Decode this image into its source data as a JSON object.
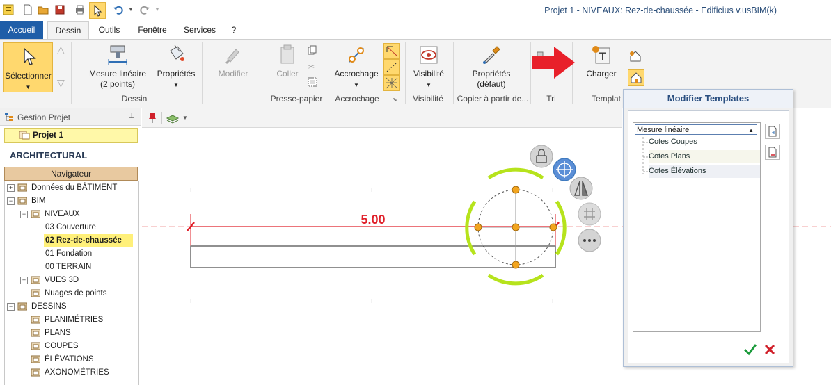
{
  "app": {
    "title": "Projet 1 -  NIVEAUX: Rez-de-chaussée - Edificius v.usBIM(k)"
  },
  "menu": {
    "tabs": [
      "Accueil",
      "Dessin",
      "Outils",
      "Fenêtre",
      "Services",
      "?"
    ]
  },
  "ribbon": {
    "select_label": "Sélectionner",
    "measure_label_1": "Mesure linéaire",
    "measure_label_2": "(2 points)",
    "properties_label": "Propriétés",
    "modify_label": "Modifier",
    "paste_label": "Coller",
    "snap_label": "Accrochage",
    "visibility_label": "Visibilité",
    "default_props_label_1": "Propriétés",
    "default_props_label_2": "(défaut)",
    "load_label": "Charger",
    "groups": {
      "dessin": "Dessin",
      "clipboard": "Presse-papier",
      "snap": "Accrochage",
      "visibility": "Visibilité",
      "copy_from": "Copier à partir de...",
      "sort": "Tri",
      "templates": "Templat"
    }
  },
  "left_panel": {
    "header": "Gestion Projet",
    "project": "Projet 1",
    "section": "ARCHITECTURAL",
    "navigator": "Navigateur",
    "tree": [
      {
        "label": "Données du BÂTIMENT",
        "level": 0,
        "expander": "+"
      },
      {
        "label": "BIM",
        "level": 0,
        "expander": "−"
      },
      {
        "label": "NIVEAUX",
        "level": 1,
        "expander": "−"
      },
      {
        "label": "03 Couverture",
        "level": 2
      },
      {
        "label": "02 Rez-de-chaussée",
        "level": 2,
        "selected": true
      },
      {
        "label": "01 Fondation",
        "level": 2
      },
      {
        "label": "00 TERRAIN",
        "level": 2
      },
      {
        "label": "VUES 3D",
        "level": 1,
        "expander": "+"
      },
      {
        "label": "Nuages de points",
        "level": 1
      },
      {
        "label": "DESSINS",
        "level": 0,
        "expander": "−"
      },
      {
        "label": "PLANIMÉTRIES",
        "level": 1
      },
      {
        "label": "PLANS",
        "level": 1
      },
      {
        "label": "COUPES",
        "level": 1
      },
      {
        "label": "ÉLÉVATIONS",
        "level": 1
      },
      {
        "label": "AXONOMÉTRIES",
        "level": 1
      }
    ]
  },
  "canvas": {
    "dimension_value": "5.00"
  },
  "dialog": {
    "title": "Modifier Templates",
    "selected_template": "Mesure linéaire",
    "items": [
      "Cotes Coupes",
      "Cotes Plans",
      "Cotes Élévations"
    ]
  },
  "colors": {
    "accent_blue": "#1f5ea8",
    "selection_yellow": "#ffd86e",
    "dimension_red": "#e0202a",
    "gizmo_green": "#b6e31c",
    "ok_green": "#1a9a3a",
    "cancel_red": "#d0202a"
  }
}
